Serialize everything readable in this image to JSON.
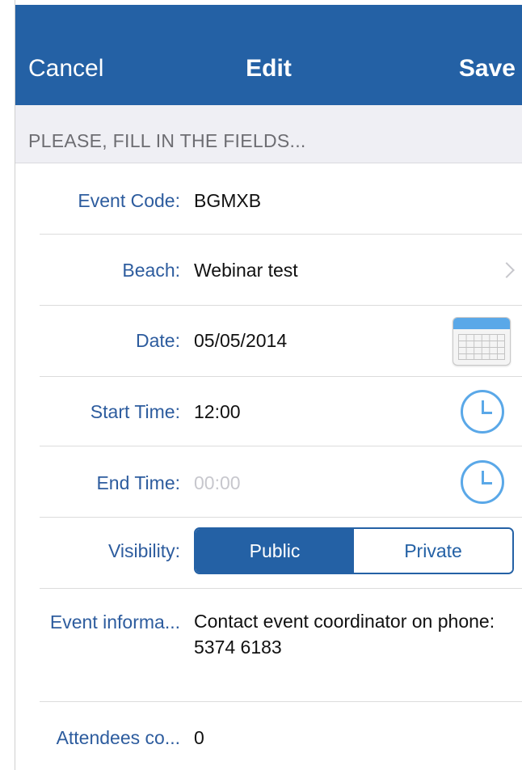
{
  "nav": {
    "cancel_label": "Cancel",
    "title": "Edit",
    "save_label": "Save"
  },
  "section": {
    "header": "PLEASE, FILL IN THE FIELDS..."
  },
  "fields": {
    "event_code": {
      "label": "Event Code:",
      "value": "BGMXB"
    },
    "beach": {
      "label": "Beach:",
      "value": "Webinar test"
    },
    "date": {
      "label": "Date:",
      "value": "05/05/2014"
    },
    "start_time": {
      "label": "Start Time:",
      "value": "12:00"
    },
    "end_time": {
      "label": "End Time:",
      "placeholder": "00:00"
    },
    "visibility": {
      "label": "Visibility:",
      "options": [
        "Public",
        "Private"
      ],
      "selected": "Public"
    },
    "event_info": {
      "label": "Event informa...",
      "value": "Contact event coordinator on phone: 5374 6183"
    },
    "attendees": {
      "label": "Attendees co...",
      "value": "0"
    }
  },
  "icons": {
    "chevron": "chevron-right-icon",
    "calendar": "calendar-icon",
    "clock": "clock-icon"
  },
  "colors": {
    "nav_bar": "#2461a5",
    "label": "#2d5c9e",
    "accent_icon": "#5aa8e8",
    "section_bg": "#efeff4",
    "placeholder": "#c7c7cd"
  }
}
